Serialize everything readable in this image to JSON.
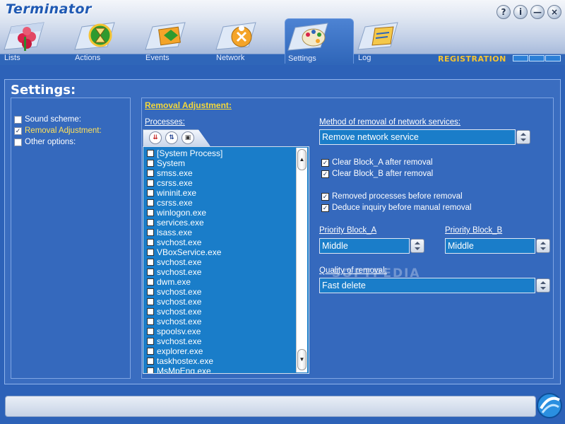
{
  "app": {
    "title": "Terminator"
  },
  "window_controls": {
    "help": "?",
    "info": "i",
    "minimize": "—",
    "close": "×"
  },
  "tabs": [
    {
      "label": "Lists",
      "icon": "clover-icon"
    },
    {
      "label": "Actions",
      "icon": "hourglass-icon"
    },
    {
      "label": "Events",
      "icon": "events-icon"
    },
    {
      "label": "Network",
      "icon": "network-icon"
    },
    {
      "label": "Settings",
      "icon": "palette-icon",
      "active": true
    },
    {
      "label": "Log",
      "icon": "log-icon"
    }
  ],
  "registration": {
    "label": "REGISTRATION"
  },
  "page": {
    "title": "Settings:"
  },
  "sidebar": {
    "items": [
      {
        "label": "Sound scheme:",
        "checked": false
      },
      {
        "label": "Removal Adjustment:",
        "checked": true
      },
      {
        "label": "Other options:",
        "checked": false
      }
    ]
  },
  "removal": {
    "title": "Removal Adjustment:",
    "processes_label": "Processes:",
    "processes": [
      "[System Process]",
      "System",
      "smss.exe",
      "csrss.exe",
      "wininit.exe",
      "csrss.exe",
      "winlogon.exe",
      "services.exe",
      "lsass.exe",
      "svchost.exe",
      "VBoxService.exe",
      "svchost.exe",
      "svchost.exe",
      "dwm.exe",
      "svchost.exe",
      "svchost.exe",
      "svchost.exe",
      "svchost.exe",
      "spoolsv.exe",
      "svchost.exe",
      "explorer.exe",
      "taskhostex.exe",
      "MsMpEng.exe"
    ],
    "method_label": "Method of removal of network services:",
    "method_value": "Remove network service",
    "options": [
      {
        "label": "Clear Block_A after removal",
        "checked": true
      },
      {
        "label": "Clear Block_B after removal",
        "checked": true
      },
      {
        "label": "Removed processes before removal",
        "checked": true
      },
      {
        "label": "Deduce inquiry before manual removal",
        "checked": true
      }
    ],
    "priority_a_label": "Priority Block_A",
    "priority_a_value": "Middle",
    "priority_b_label": "Priority Block_B",
    "priority_b_value": "Middle",
    "quality_label": "Quality of removal:",
    "quality_value": "Fast delete"
  },
  "watermark": "SOFTPEDIA",
  "colors": {
    "accent_yellow": "#f5d838",
    "list_bg": "#1a7dc9",
    "panel_bg": "#3569bd"
  }
}
